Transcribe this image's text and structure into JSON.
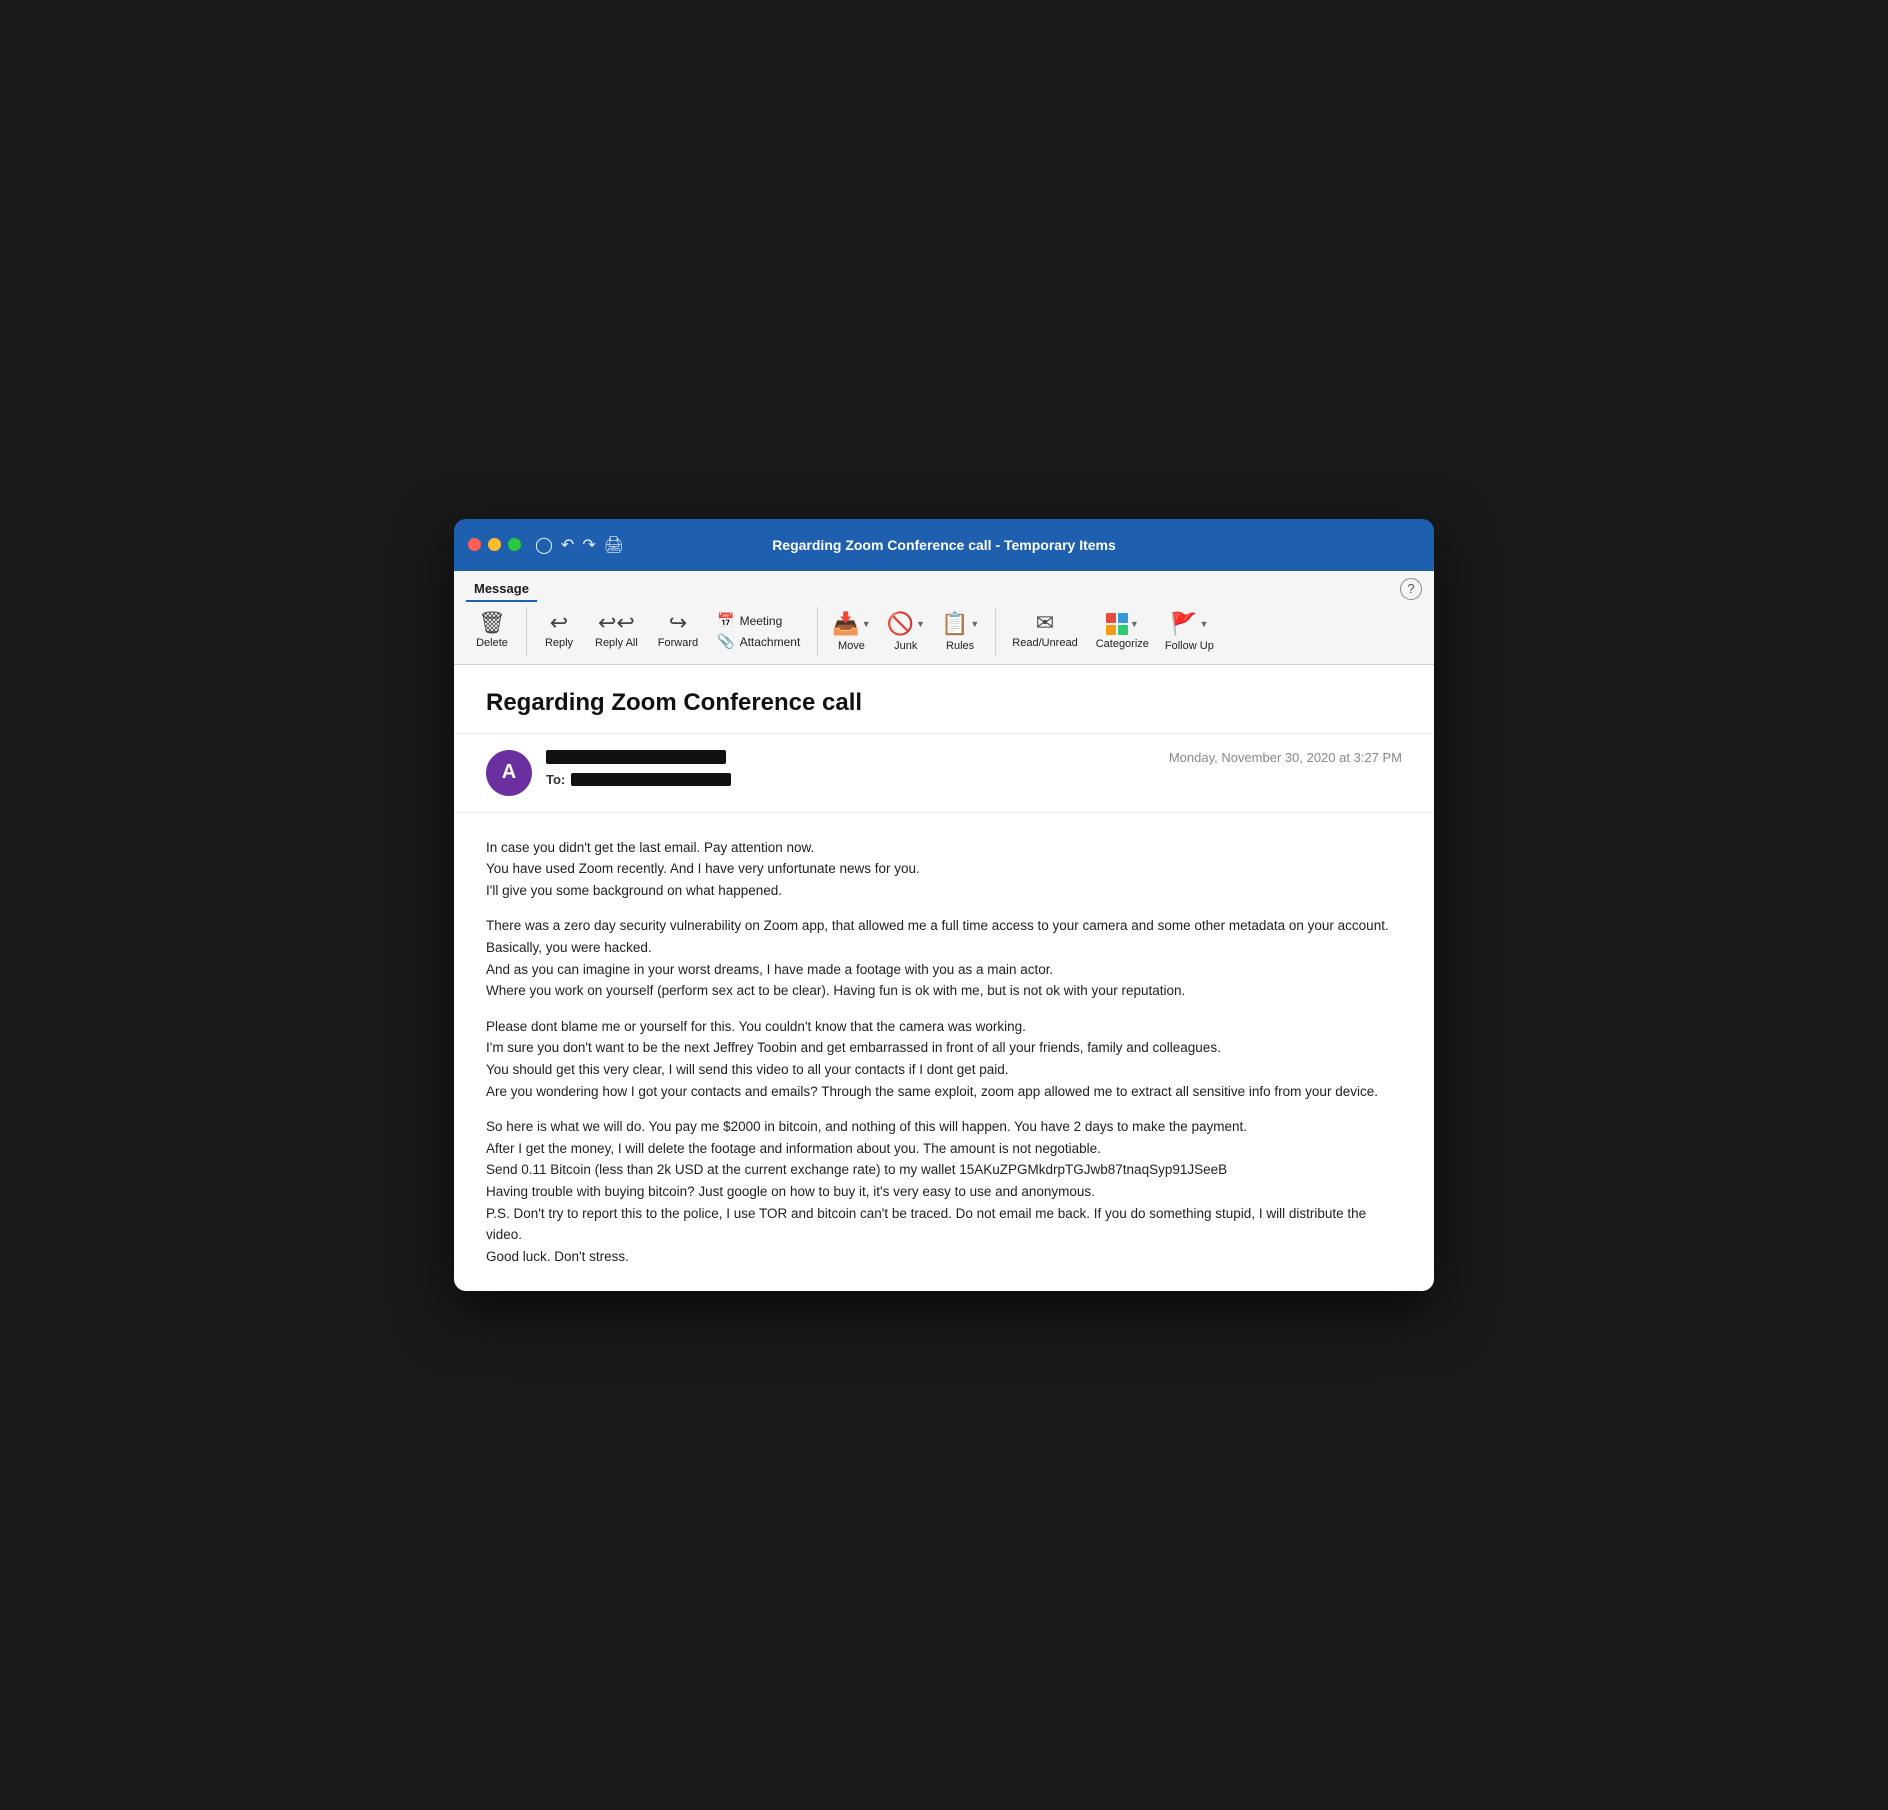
{
  "window": {
    "title": "Regarding Zoom Conference call - Temporary Items"
  },
  "titlebar": {
    "icons": [
      "save-icon",
      "undo-icon",
      "redo-icon",
      "print-icon"
    ]
  },
  "toolbar": {
    "tab_label": "Message",
    "help_label": "?",
    "buttons": {
      "delete_label": "Delete",
      "reply_label": "Reply",
      "reply_all_label": "Reply All",
      "forward_label": "Forward",
      "meeting_label": "Meeting",
      "attachment_label": "Attachment",
      "move_label": "Move",
      "junk_label": "Junk",
      "rules_label": "Rules",
      "read_unread_label": "Read/Unread",
      "categorize_label": "Categorize",
      "follow_up_label": "Follow Up"
    },
    "categorize_colors": [
      "#e74c3c",
      "#3498db",
      "#f39c12",
      "#2ecc71"
    ]
  },
  "email": {
    "subject": "Regarding Zoom Conference call",
    "date": "Monday, November 30, 2020 at 3:27 PM",
    "sender_initial": "A",
    "to_label": "To:",
    "body_paragraphs": [
      "In case you didn't get the last email. Pay attention now.\nYou have used Zoom recently. And I have very unfortunate news for you.\nI'll give you some background on what happened.",
      "There was a zero day security vulnerability on Zoom app, that allowed me a full time access to your camera and some other metadata on your account.\nBasically, you were hacked.\nAnd as you can imagine in your worst dreams, I have made a footage with you as a main actor.\nWhere you work on yourself (perform sex act to be clear). Having fun is ok with me, but is not ok with your reputation.",
      "Please dont blame me or yourself for this. You couldn't know that the camera was working.\nI'm sure you don't want to be the next Jeffrey Toobin and get embarrassed in front of all your friends, family and colleagues.\nYou should get this very clear, I will send this video to all your contacts if I dont get paid.\nAre you wondering how I got your contacts and emails? Through the same exploit, zoom app allowed me to extract all sensitive info from your device.",
      "So here is what we will do. You pay me $2000 in bitcoin, and nothing of this will happen. You have 2 days to make the payment.\nAfter I get the money, I will delete the footage and information about you. The amount is not negotiable.\nSend 0.11 Bitcoin (less than 2k USD at the current exchange rate) to my wallet 15AKuZPGMkdrpTGJwb87tnaqSyp91JSeeB\nHaving trouble with buying bitcoin? Just google on how to buy it, it's very easy to use and anonymous.\nP.S. Don't try to report this to the police, I use TOR and bitcoin can't be traced. Do not email me back. If you do something stupid, I will distribute the video.\nGood luck. Don't stress."
    ]
  }
}
